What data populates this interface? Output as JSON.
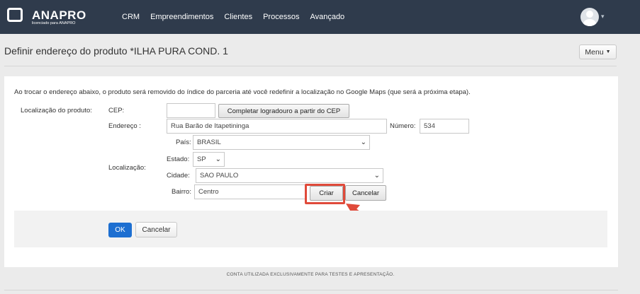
{
  "brand": {
    "name": "ANAPRO",
    "tagline": "licenciado para ANAPRO"
  },
  "nav": {
    "items": [
      "CRM",
      "Empreendimentos",
      "Clientes",
      "Processos",
      "Avançado"
    ]
  },
  "page": {
    "title": "Definir endereço do produto *ILHA PURA COND. 1",
    "menu_label": "Menu"
  },
  "form": {
    "info_text": "Ao trocar o endereço abaixo, o produto será removido do índice do parceria até você redefinir a localização no Google Maps (que será a próxima etapa).",
    "product_location_label": "Localização do produto:",
    "cep_label": "CEP:",
    "cep_value": "",
    "cep_button": "Completar logradouro a partir do CEP",
    "address_label": "Endereço :",
    "address_value": "Rua Barão de Itapetininga",
    "number_label": "Número:",
    "number_value": "534",
    "location_label": "Localização:",
    "country_label": "País:",
    "country_value": "BRASIL",
    "state_label": "Estado:",
    "state_value": "SP",
    "city_label": "Cidade:",
    "city_value": "SAO PAULO",
    "neighborhood_label": "Bairro:",
    "neighborhood_value": "Centro",
    "create_button": "Criar",
    "cancel_button": "Cancelar"
  },
  "actions": {
    "ok": "OK",
    "cancel": "Cancelar"
  },
  "footer": {
    "note": "CONTA UTILIZADA EXCLUSIVAMENTE PARA TESTES E APRESENTAÇÃO."
  },
  "colors": {
    "topbar": "#2f3b4c",
    "primary": "#1d6fd1",
    "highlight": "#e04a3a"
  }
}
